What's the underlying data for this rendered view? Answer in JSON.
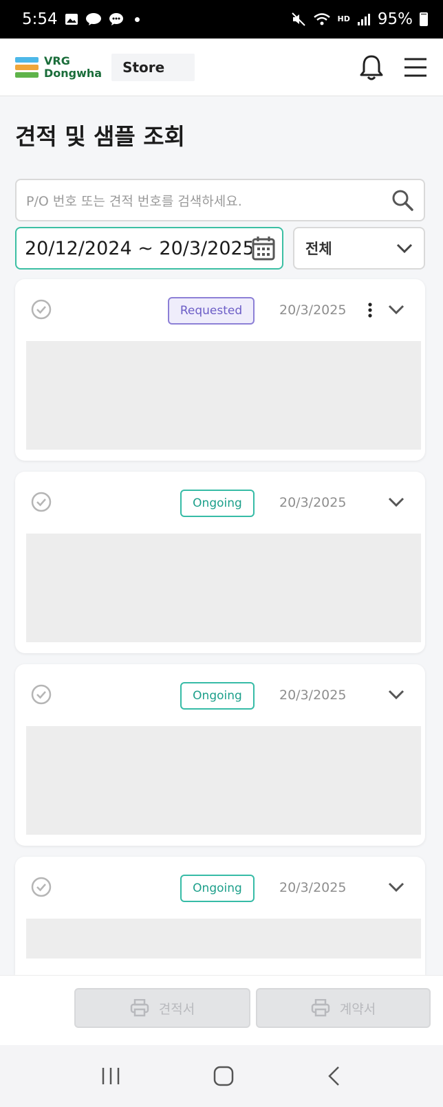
{
  "status_bar": {
    "time": "5:54",
    "battery": "95%",
    "hd_label": "HD"
  },
  "header": {
    "logo_line1": "VRG",
    "logo_line2": "Dongwha",
    "store_label": "Store",
    "icons": [
      "bell-icon",
      "hamburger-menu-icon"
    ]
  },
  "page": {
    "title": "견적 및 샘플 조회"
  },
  "search": {
    "placeholder": "P/O 번호 또는 견적 번호를 검색하세요."
  },
  "filters": {
    "date_range": "20/12/2024 ~ 20/3/2025",
    "status_select": "전체"
  },
  "cards": [
    {
      "status": "Requested",
      "date": "20/3/2025",
      "has_menu": true
    },
    {
      "status": "Ongoing",
      "date": "20/3/2025",
      "has_menu": false
    },
    {
      "status": "Ongoing",
      "date": "20/3/2025",
      "has_menu": false
    },
    {
      "status": "Ongoing",
      "date": "20/3/2025",
      "has_menu": false
    }
  ],
  "actions": {
    "quote_label": "견적서",
    "contract_label": "계약서"
  },
  "colors": {
    "accent_teal": "#36bba6",
    "requested_purple": "#8c7fd6",
    "logo_green": "#1a6d3a"
  }
}
